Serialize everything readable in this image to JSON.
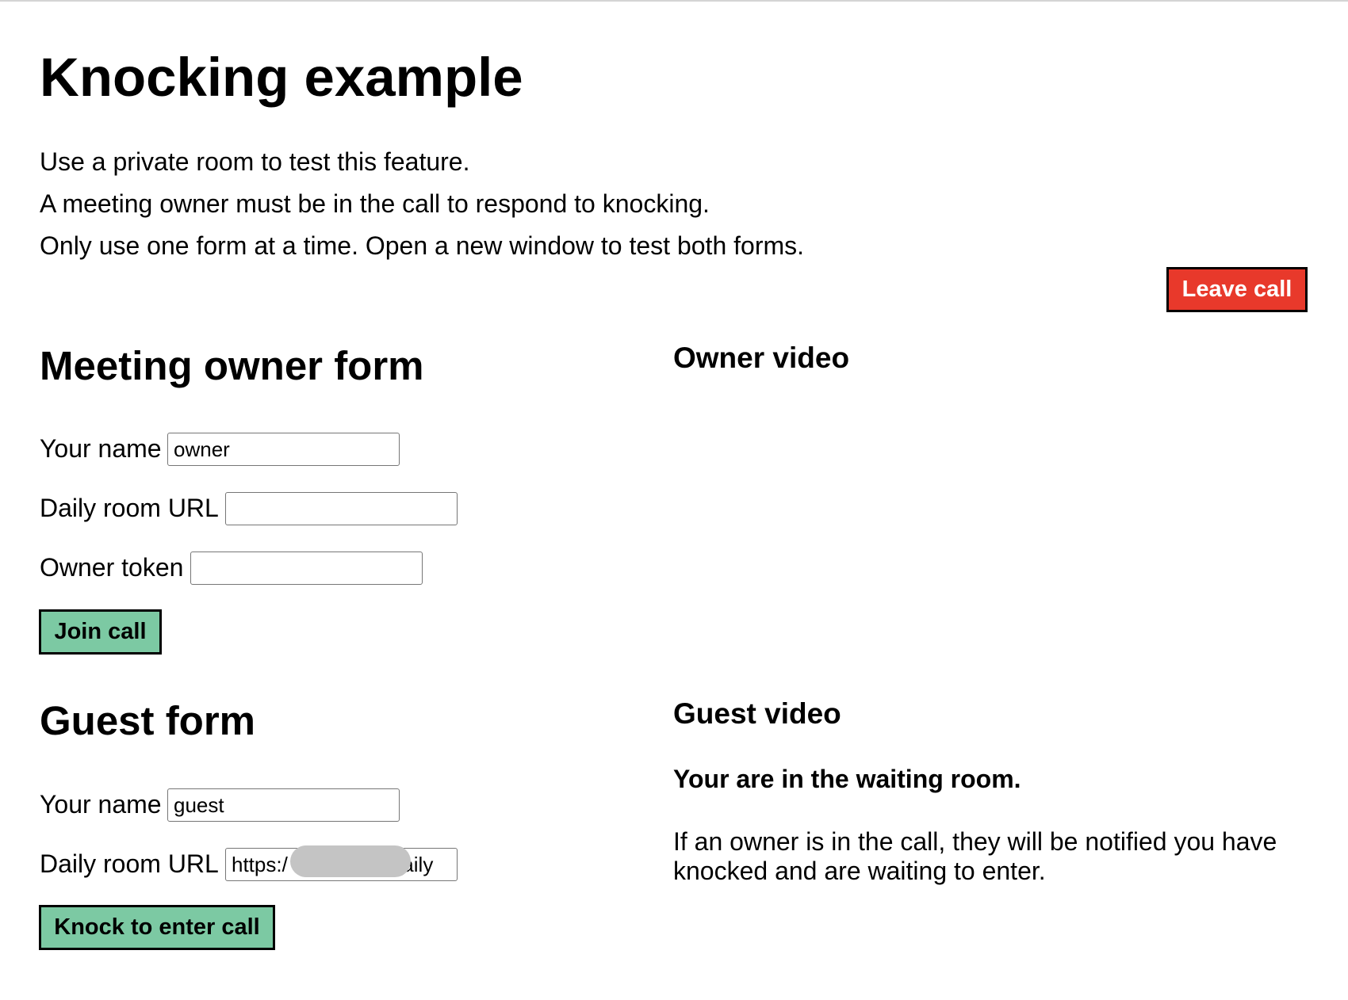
{
  "page": {
    "title": "Knocking example",
    "intro": [
      "Use a private room to test this feature.",
      "A meeting owner must be in the call to respond to knocking.",
      "Only use one form at a time. Open a new window to test both forms."
    ]
  },
  "leave_button": {
    "label": "Leave call",
    "color": "#e8392b"
  },
  "owner_form": {
    "heading": "Meeting owner form",
    "name_label": "Your name",
    "name_value": "owner",
    "url_label": "Daily room URL",
    "url_value": "",
    "token_label": "Owner token",
    "token_value": "",
    "submit_label": "Join call"
  },
  "guest_form": {
    "heading": "Guest form",
    "name_label": "Your name",
    "name_value": "guest",
    "url_label": "Daily room URL",
    "url_value": "https:/                  daily",
    "submit_label": "Knock to enter call"
  },
  "owner_video": {
    "heading": "Owner video"
  },
  "guest_video": {
    "heading": "Guest video",
    "status_title": "Your are in the waiting room.",
    "status_text": "If an owner is in the call, they will be notified you have knocked and are waiting to enter."
  },
  "colors": {
    "button_green": "#7cc9a3",
    "button_red": "#e8392b",
    "input_border": "#767676"
  }
}
